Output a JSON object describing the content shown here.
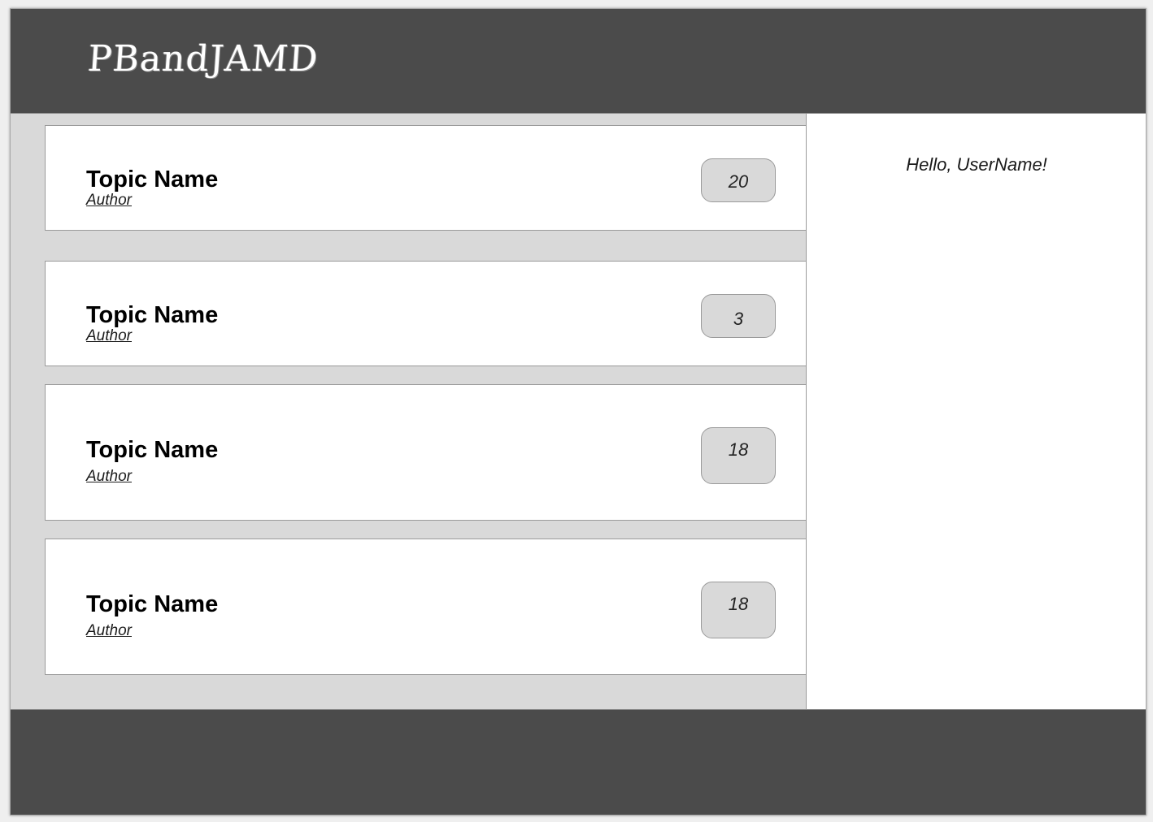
{
  "header": {
    "logo_text": "PBandJAMD"
  },
  "topics": [
    {
      "title": "Topic Name",
      "author": "Author",
      "count": "20"
    },
    {
      "title": "Topic Name",
      "author": "Author",
      "count": "3"
    },
    {
      "title": "Topic Name",
      "author": "Author",
      "count": "18"
    },
    {
      "title": "Topic Name",
      "author": "Author",
      "count": "18"
    }
  ],
  "sidebar": {
    "greeting": "Hello, UserName!"
  },
  "colors": {
    "header_bg": "#4b4b4b",
    "page_bg": "#d9d9d9",
    "card_bg": "#ffffff",
    "badge_bg": "#d9d9d9"
  }
}
